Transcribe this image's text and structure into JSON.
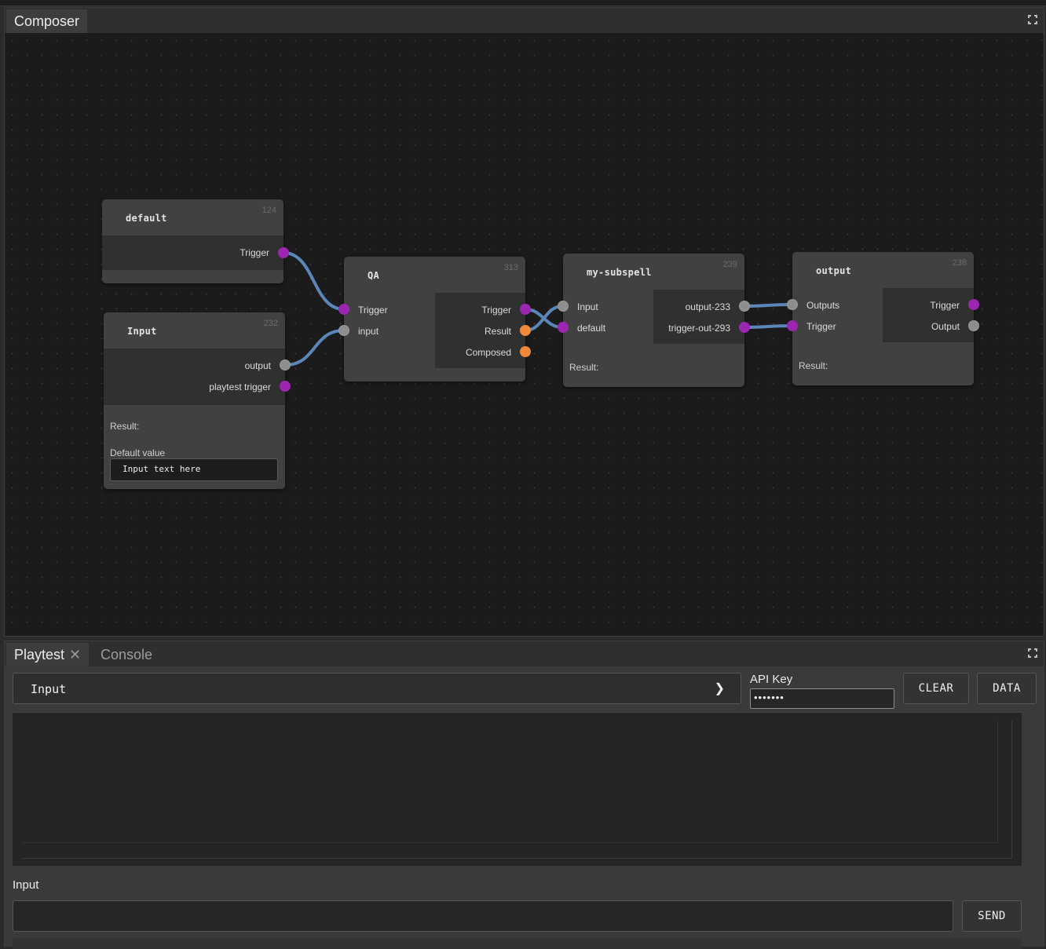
{
  "composer": {
    "tab_label": "Composer",
    "nodes": {
      "default": {
        "title": "default",
        "id": "124",
        "outputs": [
          "Trigger"
        ]
      },
      "input": {
        "title": "Input",
        "id": "232",
        "outputs": [
          "output",
          "playtest trigger"
        ],
        "result_label": "Result:",
        "default_value_label": "Default value",
        "default_value": "Input text here"
      },
      "qa": {
        "title": "QA",
        "id": "313",
        "inputs": [
          "Trigger",
          "input"
        ],
        "outputs": [
          "Trigger",
          "Result",
          "Composed"
        ]
      },
      "subspell": {
        "title": "my-subspell",
        "id": "239",
        "inputs": [
          "Input",
          "default"
        ],
        "outputs": [
          "output-233",
          "trigger-out-293"
        ],
        "result_label": "Result:"
      },
      "output": {
        "title": "output",
        "id": "238",
        "inputs": [
          "Outputs",
          "Trigger"
        ],
        "outputs": [
          "Trigger",
          "Output"
        ],
        "result_label": "Result:"
      }
    }
  },
  "playtest": {
    "tab_label": "Playtest",
    "close_glyph": "✕",
    "console_tab_label": "Console",
    "input_select_value": "Input",
    "chevron": "❯",
    "api_key_label": "API Key",
    "api_key_value": "•••••••",
    "clear_label": "CLEAR",
    "data_label": "DATA",
    "input_label": "Input",
    "input_value": "",
    "send_label": "SEND"
  },
  "colors": {
    "socket_trigger": "#9b27b0",
    "socket_data": "#8e8e8e",
    "socket_string": "#f0893a",
    "wire": "#5b86b8"
  },
  "icons": [
    "maximize-icon",
    "close-icon",
    "chevron-right-icon"
  ]
}
